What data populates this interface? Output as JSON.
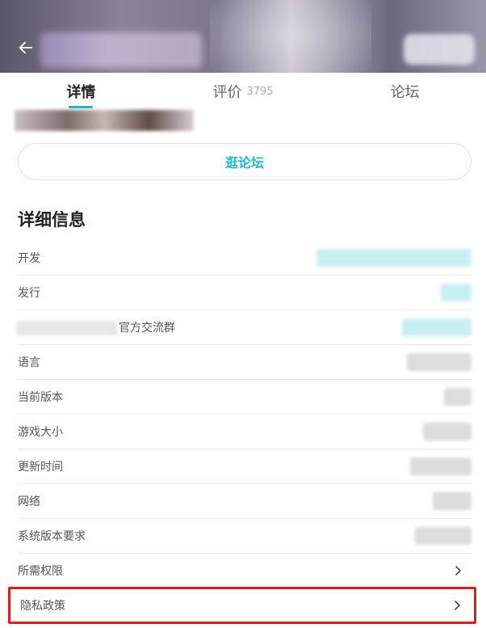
{
  "tabs": [
    {
      "label": "详情",
      "active": true
    },
    {
      "label": "评价",
      "count": "3795"
    },
    {
      "label": "论坛"
    }
  ],
  "forum_button": "逛论坛",
  "section_title": "详细信息",
  "info_rows": [
    {
      "label": "开发"
    },
    {
      "label": "发行"
    },
    {
      "label": "官方交流群"
    },
    {
      "label": "语言"
    },
    {
      "label": "当前版本"
    },
    {
      "label": "游戏大小"
    },
    {
      "label": "更新时间"
    },
    {
      "label": "网络"
    },
    {
      "label": "系统版本要求"
    },
    {
      "label": "所需权限"
    }
  ],
  "privacy_row": {
    "label": "隐私政策"
  },
  "colors": {
    "accent": "#1fb8c2",
    "highlight": "#d81e1e"
  },
  "icons": {
    "back": "arrow-left-icon",
    "chevron": "chevron-right-icon"
  }
}
